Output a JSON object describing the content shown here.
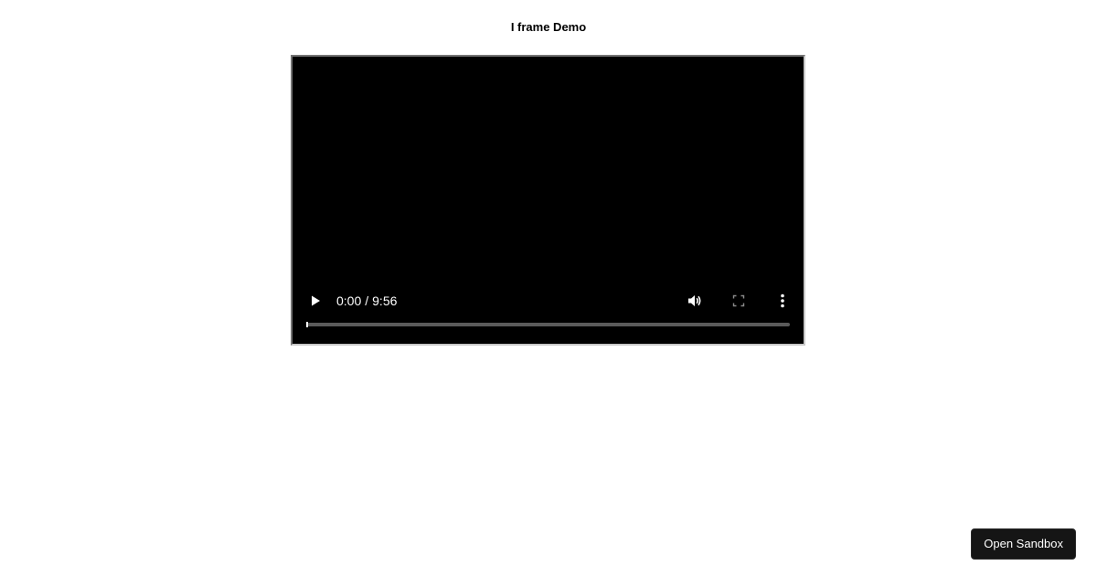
{
  "page": {
    "title": "I frame Demo"
  },
  "video": {
    "current_time": "0:00",
    "separator": "/",
    "duration": "9:56",
    "progress_fraction": 0,
    "icons": {
      "play": "play-icon",
      "volume": "volume-icon",
      "fullscreen": "fullscreen-icon",
      "more": "more-options-icon"
    }
  },
  "sandbox": {
    "button_label": "Open Sandbox"
  }
}
